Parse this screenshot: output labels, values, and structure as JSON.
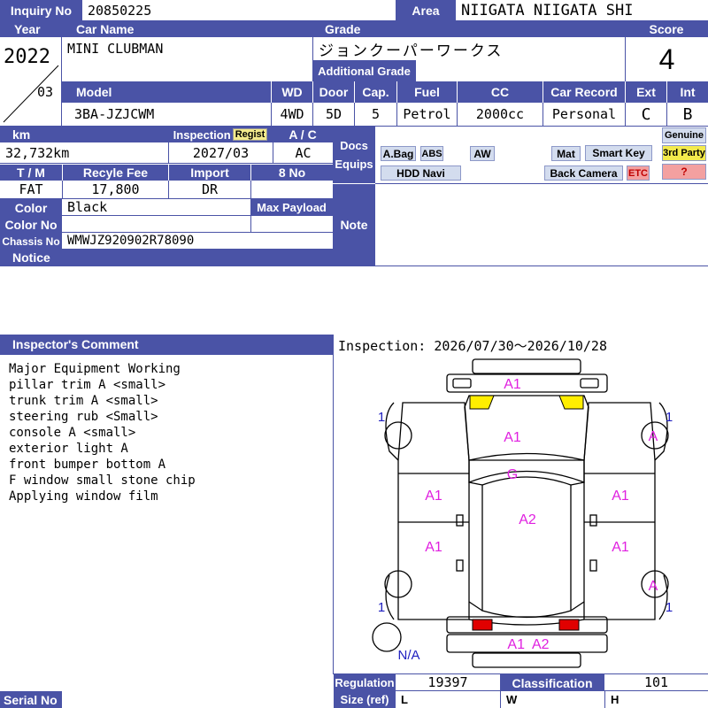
{
  "header": {
    "inquiry_label": "Inquiry No",
    "inquiry_value": "20850225",
    "area_label": "Area",
    "area_value": "NIIGATA NIIGATA SHI"
  },
  "row2": {
    "year_label": "Year",
    "car_name_label": "Car Name",
    "grade_label": "Grade",
    "score_label": "Score",
    "year_value": "2022",
    "month_value": "03",
    "car_name_value": "MINI CLUBMAN",
    "grade_value": "ジョンクーパーワークス",
    "additional_grade_label": "Additional Grade",
    "additional_grade_value": "",
    "score_value": "4"
  },
  "row3": {
    "model_label": "Model",
    "wd_label": "WD",
    "door_label": "Door",
    "cap_label": "Cap.",
    "fuel_label": "Fuel",
    "cc_label": "CC",
    "car_record_label": "Car Record",
    "ext_label": "Ext",
    "int_label": "Int",
    "model_value": "3BA-JZJCWM",
    "wd_value": "4WD",
    "door_value": "5D",
    "cap_value": "5",
    "fuel_value": "Petrol",
    "cc_value": "2000cc",
    "car_record_value": "Personal",
    "ext_value": "C",
    "int_value": "B"
  },
  "row4": {
    "km_label": "km",
    "inspection_label": "Inspection",
    "regist_badge": "Regist",
    "ac_label": "A / C",
    "km_value": "32,732km",
    "inspection_value": "2027/03",
    "ac_value": "AC",
    "tm_label": "T / M",
    "recyle_label": "Recyle Fee",
    "import_label": "Import",
    "no8_label": "8 No",
    "tm_value": "FAT",
    "recyle_value": "17,800",
    "import_value": "DR",
    "no8_value": "",
    "color_label": "Color",
    "color_value": "Black",
    "max_payload_label": "Max Payload",
    "color_no_label": "Color No",
    "color_no_value": "",
    "chassis_label": "Chassis No",
    "chassis_value": "WMWJZ920902R78090",
    "notice_label": "Notice"
  },
  "docs": {
    "docs_label": "Docs",
    "equips_label": "Equips",
    "note_label": "Note",
    "genuine": "Genuine",
    "third_party": "3rd Party",
    "question": "?",
    "chips": [
      "A.Bag",
      "ABS",
      "AW",
      "Mat",
      "Smart Key",
      "HDD Navi",
      "Back Camera",
      "ETC"
    ]
  },
  "inspector": {
    "comment_label": "Inspector's Comment",
    "lines": [
      "Major Equipment Working",
      "pillar trim A <small>",
      "trunk trim A <small>",
      "steering rub <Small>",
      "console A <small>",
      "exterior light A",
      "front bumper bottom A",
      "F window small stone chip",
      "Applying window film"
    ]
  },
  "inspection_period": "Inspection: 2026/07/30～2026/10/28",
  "diagram_marks": {
    "front": "A1",
    "hood": "A1",
    "windshield": "G",
    "roof": "A2",
    "left_front_door": "A1",
    "right_front_door": "A1",
    "left_rear_door": "A1",
    "right_rear_door": "A1",
    "right_front_wheel": "A",
    "right_rear_wheel": "A",
    "rear": "A1  A2",
    "spare": "N/A",
    "corner_tl": "1",
    "corner_tr": "1",
    "corner_bl": "1",
    "corner_br": "1"
  },
  "bottom": {
    "regulation_label": "Regulation",
    "regulation_value": "19397",
    "classification_label": "Classification",
    "classification_value": "101",
    "size_label": "Size (ref)",
    "l_label": "L",
    "w_label": "W",
    "h_label": "H",
    "serial_label": "Serial No"
  },
  "colors": {
    "header_bg": "#4a53a6",
    "mark_color": "#e020e0",
    "light_yellow": "#ffee00",
    "light_red": "#e00000"
  }
}
